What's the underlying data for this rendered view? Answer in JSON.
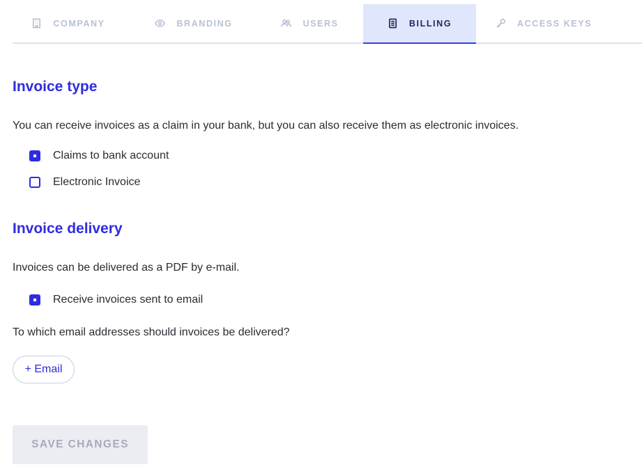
{
  "tabs": [
    {
      "label": "COMPANY",
      "icon": "building-icon",
      "active": false
    },
    {
      "label": "BRANDING",
      "icon": "eye-icon",
      "active": false
    },
    {
      "label": "USERS",
      "icon": "users-icon",
      "active": false
    },
    {
      "label": "BILLING",
      "icon": "document-icon",
      "active": true
    },
    {
      "label": "ACCESS KEYS",
      "icon": "key-icon",
      "active": false
    }
  ],
  "invoice_type": {
    "heading": "Invoice type",
    "description": "You can receive invoices as a claim in your bank, but you can also receive them as electronic invoices.",
    "options": [
      {
        "label": "Claims to bank account",
        "checked": true
      },
      {
        "label": "Electronic Invoice",
        "checked": false
      }
    ]
  },
  "invoice_delivery": {
    "heading": "Invoice delivery",
    "description": "Invoices can be delivered as a PDF by e-mail.",
    "email_option": {
      "label": "Receive invoices sent to email",
      "checked": true
    },
    "email_question": "To which email addresses should invoices be delivered?",
    "add_email_label": "+ Email"
  },
  "save_label": "SAVE CHANGES",
  "colors": {
    "accent": "#2f2ce0",
    "active_tab_bg": "#e0e6fb",
    "inactive_tab": "#b9c0d3",
    "save_disabled_bg": "#ececf3"
  }
}
